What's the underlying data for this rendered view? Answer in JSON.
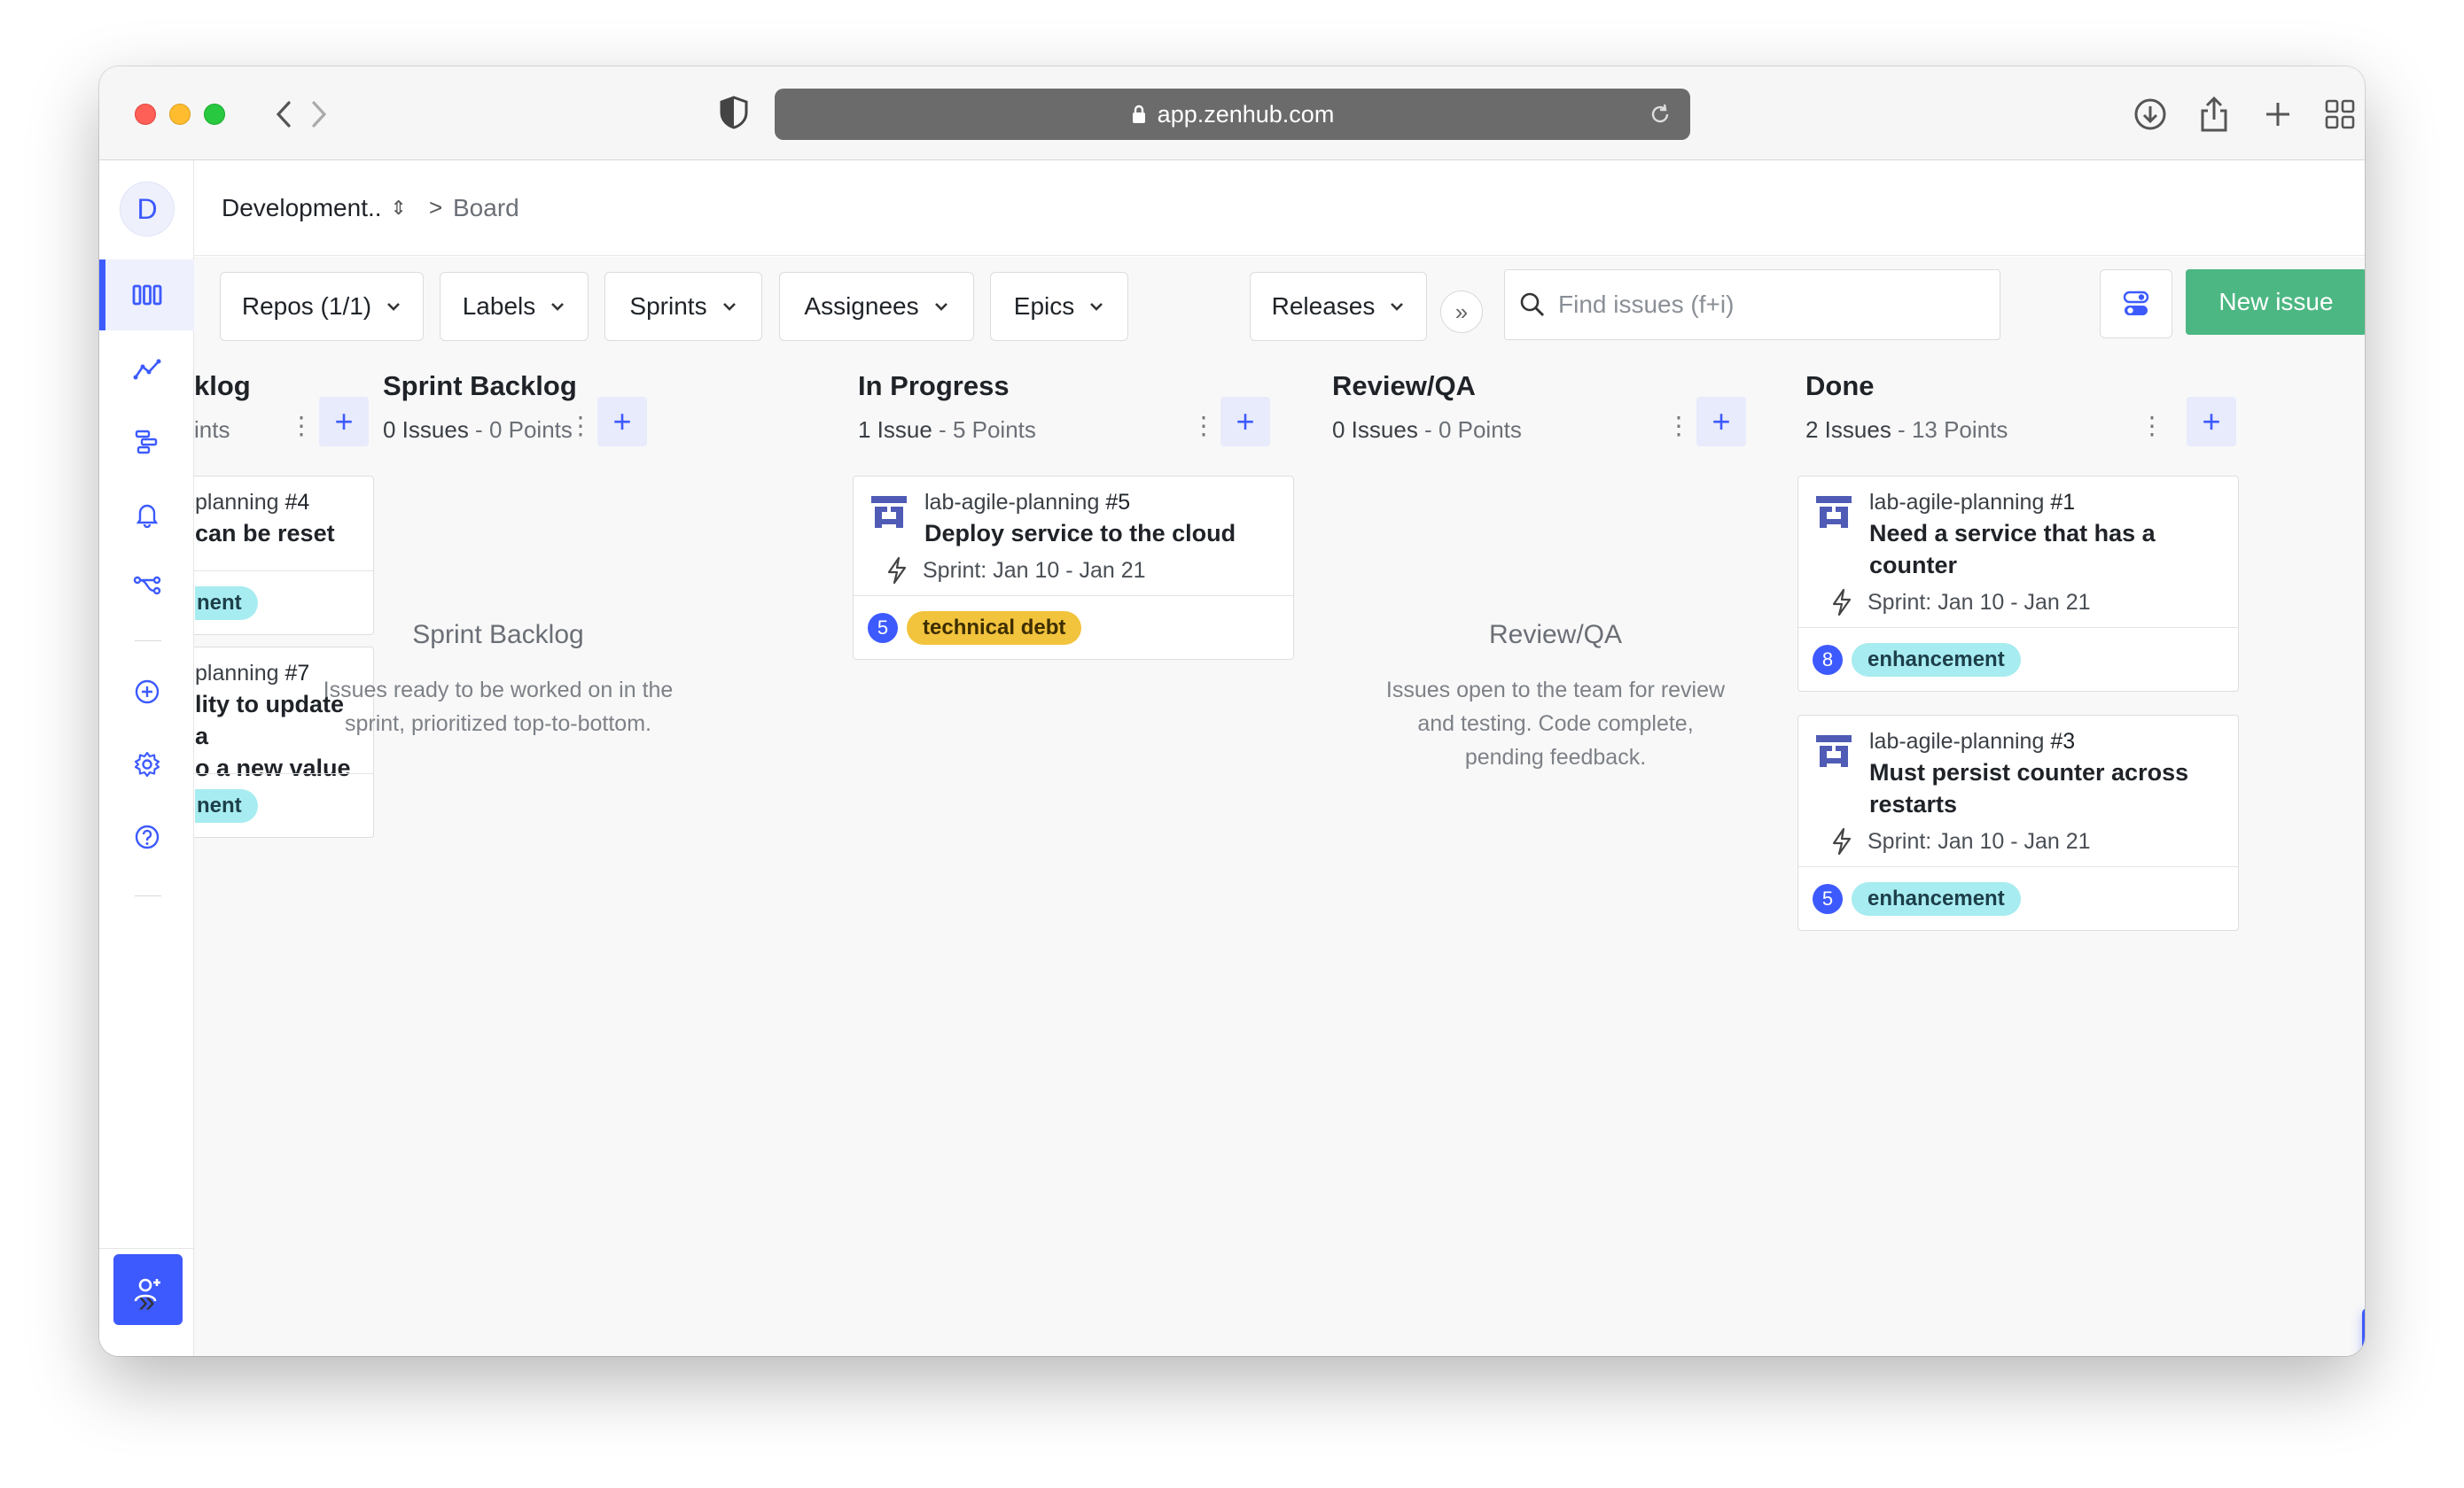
{
  "browser": {
    "url": "app.zenhub.com"
  },
  "sidebar": {
    "workspace_initial": "D",
    "expand_label": "»"
  },
  "header": {
    "workspace": "Development..",
    "breadcrumb_sep": ">",
    "page": "Board"
  },
  "toolbar": {
    "filters": [
      "Repos (1/1)",
      "Labels",
      "Sprints",
      "Assignees",
      "Epics",
      "Releases"
    ],
    "more": "»",
    "search_placeholder": "Find issues (f+i)",
    "new_issue": "New issue",
    "add": "+"
  },
  "columns": [
    {
      "title": "klog",
      "count": "",
      "points": "ints",
      "cards": [
        {
          "repo": "planning",
          "number": "#4",
          "title_lines": [
            "can be reset"
          ],
          "estimate": "",
          "label": "nent"
        },
        {
          "repo": "planning",
          "number": "#7",
          "title_lines": [
            "lity to update a",
            "o a new value"
          ],
          "estimate": "",
          "label": "nent"
        }
      ]
    },
    {
      "title": "Sprint Backlog",
      "count": "0 Issues",
      "points": "0 Points",
      "empty_title": "Sprint Backlog",
      "empty_desc": "Issues ready to be worked on in the sprint, prioritized top-to-bottom."
    },
    {
      "title": "In Progress",
      "count": "1 Issue",
      "points": "5 Points",
      "cards": [
        {
          "repo": "lab-agile-planning",
          "number": "#5",
          "title_lines": [
            "Deploy service to the cloud"
          ],
          "sprint": "Sprint: Jan 10 - Jan 21",
          "estimate": "5",
          "label": "technical debt"
        }
      ]
    },
    {
      "title": "Review/QA",
      "count": "0 Issues",
      "points": "0 Points",
      "empty_title": "Review/QA",
      "empty_desc": "Issues open to the team for review and testing. Code complete, pending feedback."
    },
    {
      "title": "Done",
      "count": "2 Issues",
      "points": "13 Points",
      "cards": [
        {
          "repo": "lab-agile-planning",
          "number": "#1",
          "title_lines": [
            "Need a service that has a",
            "counter"
          ],
          "sprint": "Sprint: Jan 10 - Jan 21",
          "estimate": "8",
          "label": "enhancement"
        },
        {
          "repo": "lab-agile-planning",
          "number": "#3",
          "title_lines": [
            "Must persist counter across",
            "restarts"
          ],
          "sprint": "Sprint: Jan 10 - Jan 21",
          "estimate": "5",
          "label": "enhancement"
        }
      ]
    }
  ],
  "colors": {
    "accent": "#3d5afe",
    "green": "#4cb782",
    "enhancement": "#a7ecf0",
    "technical_debt": "#f2c33c"
  }
}
